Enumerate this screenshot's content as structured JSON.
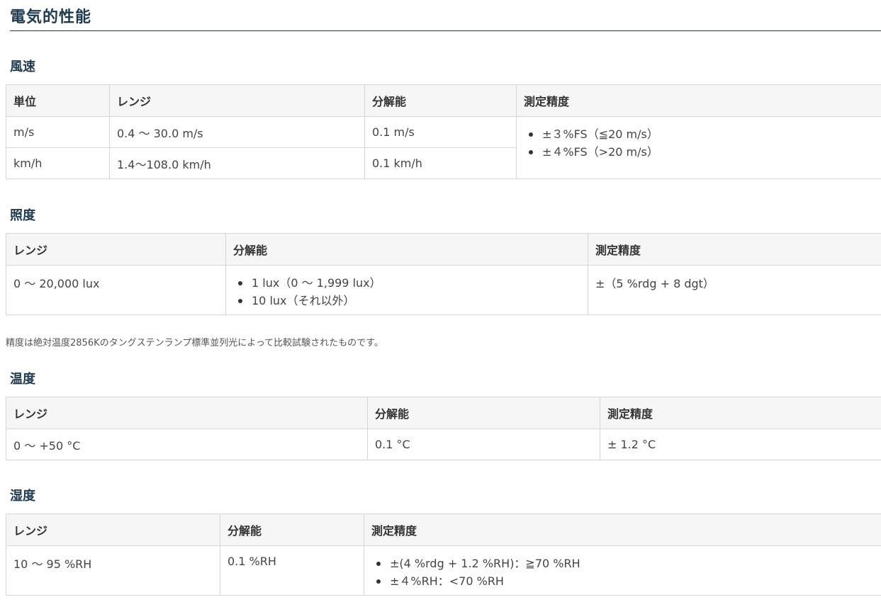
{
  "title": "電気的性能",
  "wind": {
    "heading": "風速",
    "headers": [
      "単位",
      "レンジ",
      "分解能",
      "測定精度"
    ],
    "rows": [
      {
        "unit": "m/s",
        "range": "0.4 ～ 30.0 m/s",
        "resolution": "0.1 m/s"
      },
      {
        "unit": "km/h",
        "range": "1.4～108.0 km/h",
        "resolution": "0.1 km/h"
      }
    ],
    "accuracy": [
      "±３%FS（≦20 m/s）",
      "±４%FS（>20 m/s）"
    ]
  },
  "illuminance": {
    "heading": "照度",
    "headers": [
      "レンジ",
      "分解能",
      "測定精度"
    ],
    "range": "0 ～ 20,000 lux",
    "resolution": [
      "1 lux（0 ～ 1,999 lux）",
      "10 lux（それ以外）"
    ],
    "accuracy": "±（5 %rdg + 8 dgt）",
    "note": "精度は絶対温度2856Kのタングステンランプ標準並列光によって比較試験されたものです。"
  },
  "temperature": {
    "heading": "温度",
    "headers": [
      "レンジ",
      "分解能",
      "測定精度"
    ],
    "range": "0 ～ +50 °C",
    "resolution": "0.1 °C",
    "accuracy": "± 1.2 °C"
  },
  "humidity": {
    "heading": "湿度",
    "headers": [
      "レンジ",
      "分解能",
      "測定精度"
    ],
    "range": "10 ～ 95 %RH",
    "resolution": "0.1 %RH",
    "accuracy": [
      "±(4 %rdg + 1.2 %RH)：≧70 %RH",
      "±４%RH：<70 %RH"
    ]
  },
  "colors": {
    "heading": "#1f3a4f",
    "header_bg": "#f6f6f6",
    "border": "#d6d6d6"
  }
}
